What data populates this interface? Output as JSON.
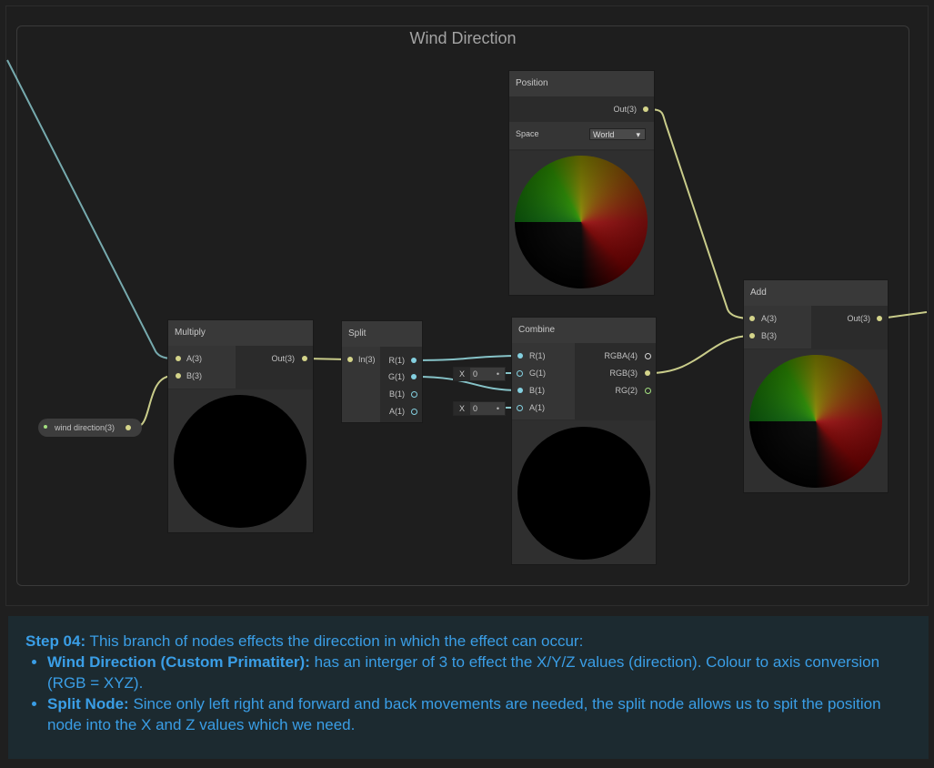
{
  "graph": {
    "group_title": "Wind Direction"
  },
  "nodes": {
    "position": {
      "title": "Position",
      "output": "Out(3)",
      "space_label": "Space",
      "space_value": "World",
      "dropdown_icon": "caret-down-icon"
    },
    "multiply": {
      "title": "Multiply",
      "input_a": "A(3)",
      "input_b": "B(3)",
      "output": "Out(3)"
    },
    "split": {
      "title": "Split",
      "input": "In(3)",
      "out_r": "R(1)",
      "out_g": "G(1)",
      "out_b": "B(1)",
      "out_a": "A(1)"
    },
    "combine": {
      "title": "Combine",
      "in_r": "R(1)",
      "in_g": "G(1)",
      "in_b": "B(1)",
      "in_a": "A(1)",
      "out_rgba": "RGBA(4)",
      "out_rgb": "RGB(3)",
      "out_rg": "RG(2)",
      "g_field_label": "X",
      "g_field_value": "0",
      "a_field_label": "X",
      "a_field_value": "0"
    },
    "add": {
      "title": "Add",
      "input_a": "A(3)",
      "input_b": "B(3)",
      "output": "Out(3)"
    },
    "property": {
      "label": "wind direction(3)"
    }
  },
  "colors": {
    "vector3_wire": "#c9cc8a",
    "float_wire": "#86c3c8",
    "info_text": "#3a9ee6"
  },
  "info": {
    "step_label": "Step 04:",
    "step_text": " This branch of nodes effects the direcction in which the effect can occur:",
    "bullets": [
      {
        "bold": "Wind Direction (Custom Primatiter):",
        "text": " has an interger of 3 to effect the X/Y/Z values (direction). Colour to axis conversion (RGB = XYZ)."
      },
      {
        "bold": "Split Node:",
        "text": " Since only left right and forward and back movements are needed, the split node allows us to spit the position node into the X and Z values which we need."
      }
    ]
  }
}
